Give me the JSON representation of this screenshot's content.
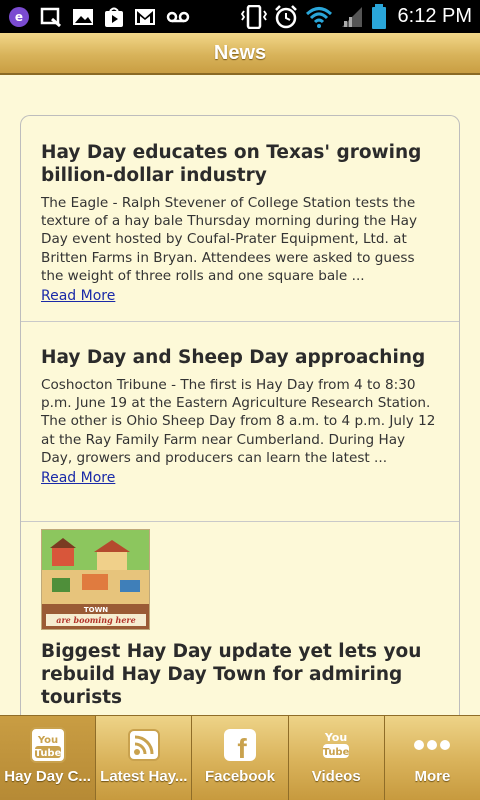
{
  "status_bar": {
    "time": "6:12 PM",
    "icons": [
      "eclipse-app-icon",
      "data-sync-icon",
      "gallery-icon",
      "play-store-icon",
      "gmail-icon",
      "voicemail-icon",
      "vibrate-icon",
      "alarm-icon",
      "wifi-icon",
      "signal-icon",
      "battery-icon"
    ]
  },
  "header": {
    "title": "News"
  },
  "articles": [
    {
      "title": "Hay Day educates on Texas' growing billion-dollar industry",
      "summary": "The Eagle - Ralph Stevener of College Station tests the texture of a hay bale Thursday morning during the Hay Day event hosted by Coufal-Prater Equipment, Ltd. at Britten Farms in Bryan. Attendees were asked to guess the weight of three rolls and one square bale ...",
      "link": "Read More"
    },
    {
      "title": "Hay Day and Sheep Day approaching",
      "summary": "Coshocton Tribune - The first is Hay Day from 4 to 8:30 p.m. June 19 at the Eastern Agriculture Research Station. The other is Ohio Sheep Day from 8 a.m. to 4 p.m. July 12 at the Ray Family Farm near Cumberland. During Hay Day, growers and producers can learn the latest ...",
      "link": "Read More"
    },
    {
      "title": "Biggest Hay Day update yet lets you rebuild Hay Day Town for admiring tourists",
      "thumbnail_caption": "TOWN\nare booming here"
    }
  ],
  "tabs": [
    {
      "label": "Hay Day C...",
      "icon": "youtube-icon"
    },
    {
      "label": "Latest Hay...",
      "icon": "rss-icon"
    },
    {
      "label": "Facebook",
      "icon": "facebook-icon"
    },
    {
      "label": "Videos",
      "icon": "youtube-icon"
    },
    {
      "label": "More",
      "icon": "more-dots-icon"
    }
  ],
  "colors": {
    "header_gold": "#d8b35a",
    "background": "#fdf9d8",
    "link": "#1a2aa8"
  }
}
